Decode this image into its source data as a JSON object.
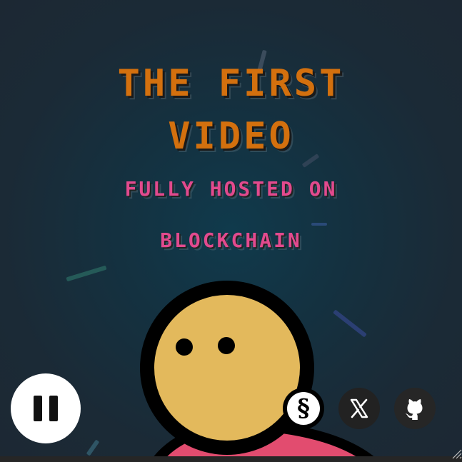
{
  "hero": {
    "title_line1": "THE FIRST",
    "title_line2": "VIDEO",
    "subtitle_line1": "FULLY HOSTED ON",
    "subtitle_line2": "BLOCKCHAIN"
  },
  "controls": {
    "playback_state": "playing",
    "pause_icon": "pause-icon"
  },
  "social_links": [
    {
      "name": "s-logo",
      "glyph": "§"
    },
    {
      "name": "x-logo",
      "glyph": "𝕏"
    },
    {
      "name": "github-logo",
      "glyph": ""
    }
  ],
  "colors": {
    "title": "#d3700e",
    "subtitle": "#e24a8e",
    "mascot_face": "#e3b95c",
    "mascot_body": "#e24c6f",
    "background": "#143140"
  }
}
